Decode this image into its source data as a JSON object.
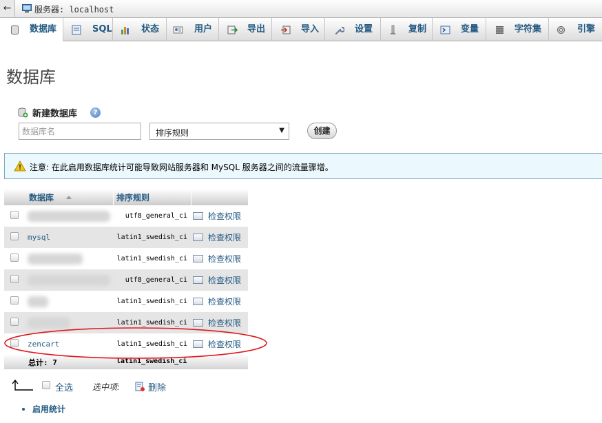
{
  "topbar": {
    "back_label": "←",
    "server_label": "服务器: localhost"
  },
  "tabs": [
    {
      "label": "数据库",
      "icon": "database-icon",
      "active": true
    },
    {
      "label": "SQL",
      "icon": "sql-icon"
    },
    {
      "label": "状态",
      "icon": "status-chart-icon"
    },
    {
      "label": "用户",
      "icon": "users-icon"
    },
    {
      "label": "导出",
      "icon": "export-icon"
    },
    {
      "label": "导入",
      "icon": "import-icon"
    },
    {
      "label": "设置",
      "icon": "wrench-icon"
    },
    {
      "label": "复制",
      "icon": "replication-icon"
    },
    {
      "label": "变量",
      "icon": "variables-icon"
    },
    {
      "label": "字符集",
      "icon": "charset-icon"
    },
    {
      "label": "引擎",
      "icon": "engine-icon"
    }
  ],
  "page_title": "数据库",
  "create_db": {
    "heading": "新建数据库",
    "help_label": "?",
    "name_placeholder": "数据库名",
    "collation_value": "排序规则",
    "create_button": "创建"
  },
  "notice": {
    "text": "注意: 在此启用数据库统计可能导致网站服务器和 MySQL 服务器之间的流量骤增。"
  },
  "table": {
    "columns": {
      "database": "数据库",
      "collation": "排序规则"
    },
    "check_privileges_label": "检查权限",
    "rows": [
      {
        "name": "",
        "collation": "utf8_general_ci",
        "blurred": true
      },
      {
        "name": "mysql",
        "collation": "latin1_swedish_ci",
        "blurred": false
      },
      {
        "name": "",
        "collation": "latin1_swedish_ci",
        "blurred": true
      },
      {
        "name": "",
        "collation": "utf8_general_ci",
        "blurred": true
      },
      {
        "name": "",
        "collation": "latin1_swedish_ci",
        "blurred": true
      },
      {
        "name": "",
        "collation": "latin1_swedish_ci",
        "blurred": true
      },
      {
        "name": "zencart",
        "collation": "latin1_swedish_ci",
        "blurred": false
      }
    ],
    "total_label": "总计: 7",
    "total_collation": "latin1_swedish_ci"
  },
  "actions": {
    "select_all_label": "全选",
    "with_selected_label": "选中项:",
    "delete_label": "删除",
    "enable_stats_label": "启用统计"
  },
  "colors": {
    "link": "#235a81",
    "highlight_ellipse": "#e0181e",
    "notice_bg": "#ebf8fd"
  }
}
